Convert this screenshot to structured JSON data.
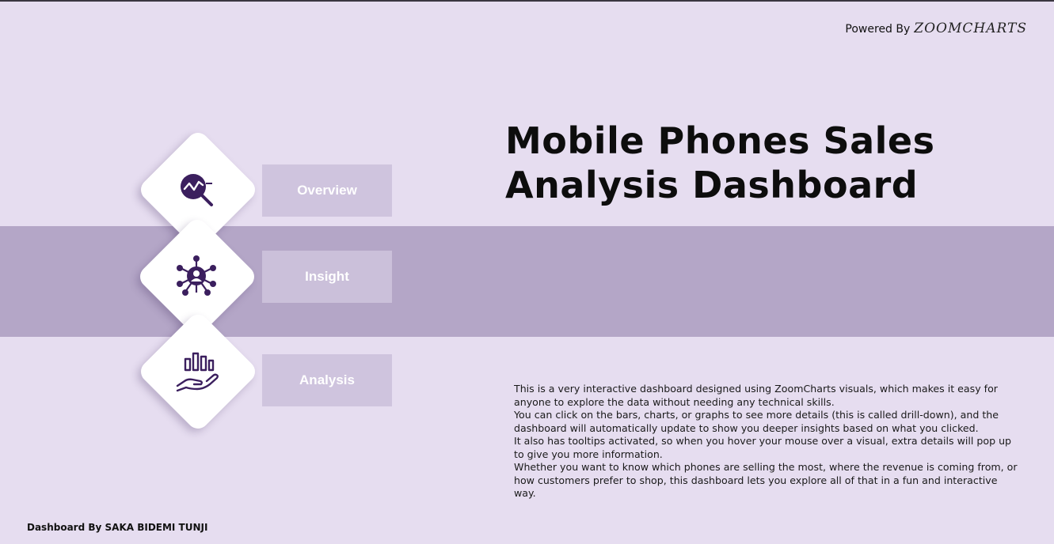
{
  "header": {
    "powered_label": "Powered By",
    "powered_brand": "ZOOMCHARTS"
  },
  "title": "Mobile  Phones Sales\nAnalysis Dashboard",
  "nav": [
    {
      "label": "Overview",
      "icon": "analytics-search-icon"
    },
    {
      "label": "Insight",
      "icon": "network-user-icon"
    },
    {
      "label": "Analysis",
      "icon": "hand-chart-icon"
    }
  ],
  "description": [
    "This is a very interactive dashboard designed using ZoomCharts visuals, which makes it easy for anyone to explore the data without needing any technical skills.",
    "You can click on the bars, charts, or graphs to see more details (this is called drill-down), and the dashboard will automatically update to show you deeper insights based on what you clicked.",
    "It also has tooltips activated, so when you hover your mouse over a visual, extra details will pop up to give you more information.",
    "Whether you want to know which phones are selling the most, where the revenue is coming from, or how customers prefer to shop, this dashboard lets you explore all of that in a fun and interactive way."
  ],
  "footer": {
    "credit": "Dashboard By SAKA BIDEMI TUNJI"
  },
  "colors": {
    "background": "#e6ddf0",
    "band": "#b4a6c7",
    "button": "#cfc4de",
    "icon": "#3b1f5e"
  }
}
